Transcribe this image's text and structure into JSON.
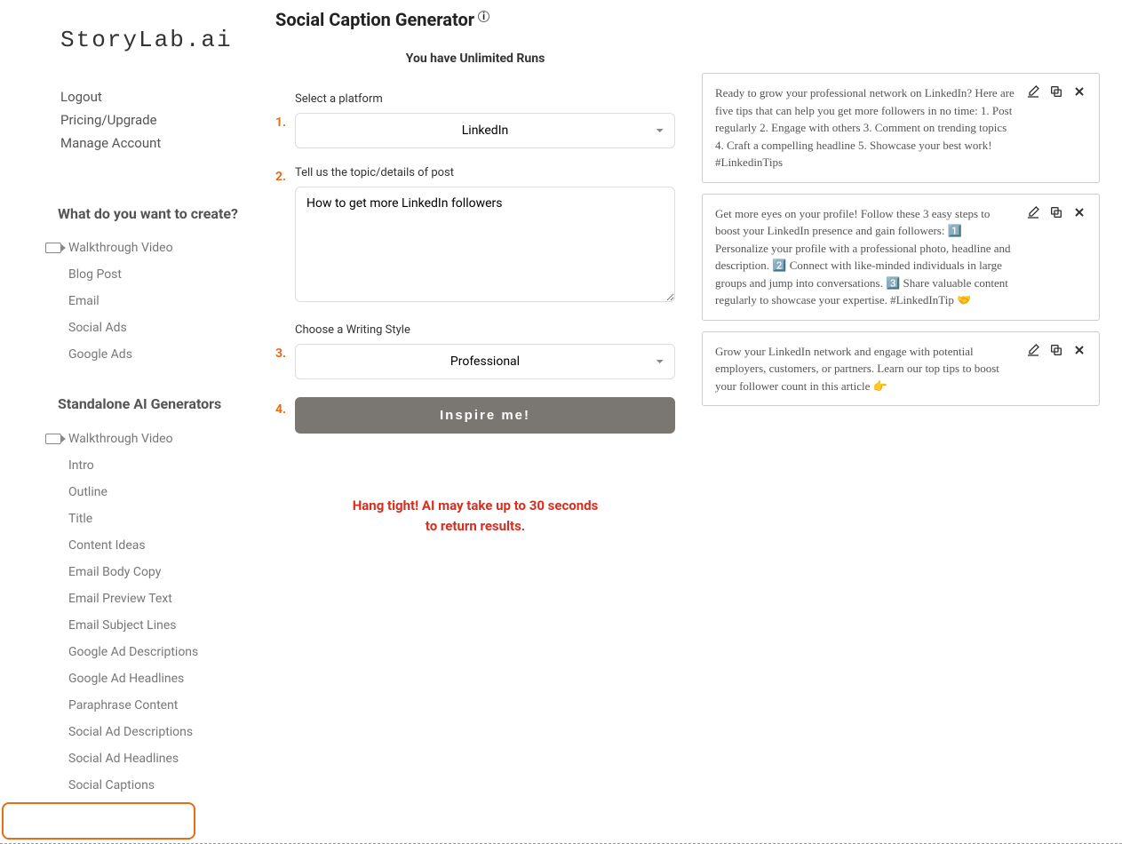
{
  "logo": "StoryLab.ai",
  "account_links": {
    "logout": "Logout",
    "pricing": "Pricing/Upgrade",
    "manage": "Manage Account"
  },
  "sidebar": {
    "section1_header": "What do you want to create?",
    "section1_items": [
      "Walkthrough Video",
      "Blog Post",
      "Email",
      "Social Ads",
      "Google Ads"
    ],
    "section2_header": "Standalone AI Generators",
    "section2_items": [
      "Walkthrough Video",
      "Intro",
      "Outline",
      "Title",
      "Content Ideas",
      "Email Body Copy",
      "Email Preview Text",
      "Email Subject Lines",
      "Google Ad Descriptions",
      "Google Ad Headlines",
      "Paraphrase Content",
      "Social Ad Descriptions",
      "Social Ad Headlines",
      "Social Captions"
    ]
  },
  "page_title": "Social Caption Generator",
  "runs_line": "You have Unlimited Runs",
  "form": {
    "step1_label": "Select a platform",
    "step1_value": "LinkedIn",
    "step2_label": "Tell us the topic/details of post",
    "step2_value": "How to get more LinkedIn followers",
    "step3_label": "Choose a Writing Style",
    "step3_value": "Professional",
    "button": "Inspire me!",
    "steps": {
      "s1": "1.",
      "s2": "2.",
      "s3": "3.",
      "s4": "4."
    }
  },
  "wait_msg_line1": "Hang tight! AI may take up to 30 seconds",
  "wait_msg_line2": "to return results.",
  "results": [
    "Ready to grow your professional network on LinkedIn? Here are five tips that can help you get more followers in no time: 1. Post regularly 2. Engage with others 3. Comment on trending topics 4. Craft a compelling headline 5. Showcase your best work! #LinkedinTips",
    "Get more eyes on your profile! Follow these 3 easy steps to boost your LinkedIn presence and gain followers: 1️⃣ Personalize your profile with a professional photo, headline and description. 2️⃣ Connect with like-minded individuals in large groups and jump into conversations. 3️⃣ Share valuable content regularly to showcase your expertise. #LinkedInTip 🤝",
    "Grow your LinkedIn network and engage with potential employers, customers, or partners. Learn our top tips to boost your follower count in this article 👉"
  ]
}
